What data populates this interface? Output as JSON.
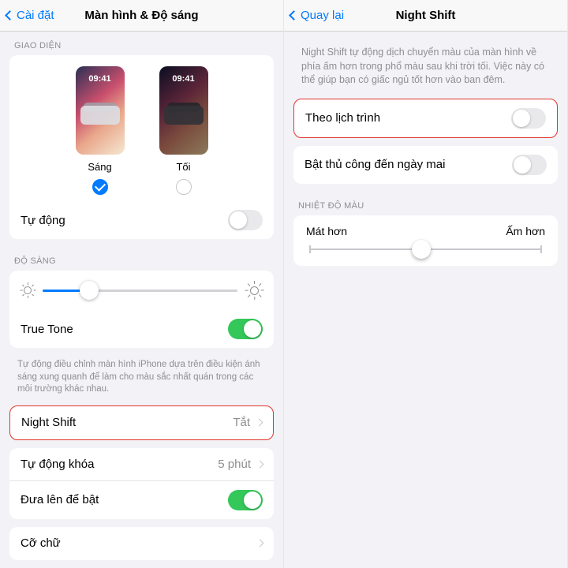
{
  "left": {
    "nav": {
      "back": "Cài đặt",
      "title": "Màn hình & Độ sáng"
    },
    "sections": {
      "appearance_header": "GIAO DIỆN",
      "brightness_header": "ĐỘ SÁNG"
    },
    "appearance": {
      "light_label": "Sáng",
      "dark_label": "Tối",
      "preview_time": "09:41",
      "selected": "light",
      "auto_label": "Tự động",
      "auto_on": false
    },
    "brightness": {
      "value_pct": 24,
      "truetone_label": "True Tone",
      "truetone_on": true,
      "truetone_footnote": "Tự động điều chỉnh màn hình iPhone dựa trên điều kiện ánh sáng xung quanh để làm cho màu sắc nhất quán trong các môi trường khác nhau."
    },
    "nightshift": {
      "label": "Night Shift",
      "value": "Tắt"
    },
    "autolock": {
      "label": "Tự động khóa",
      "value": "5 phút"
    },
    "raise": {
      "label": "Đưa lên để bật",
      "on": true
    },
    "textsize": {
      "label": "Cỡ chữ"
    }
  },
  "right": {
    "nav": {
      "back": "Quay lại",
      "title": "Night Shift"
    },
    "description": "Night Shift tự động dịch chuyển màu của màn hình về phía ấm hơn trong phổ màu sau khi trời tối. Việc này có thể giúp bạn có giấc ngủ tốt hơn vào ban đêm.",
    "scheduled": {
      "label": "Theo lịch trình",
      "on": false
    },
    "manual": {
      "label": "Bật thủ công đến ngày mai",
      "on": false
    },
    "temp": {
      "header": "NHIỆT ĐỘ MÀU",
      "cooler": "Mát hơn",
      "warmer": "Ấm hơn",
      "value_pct": 48
    }
  }
}
